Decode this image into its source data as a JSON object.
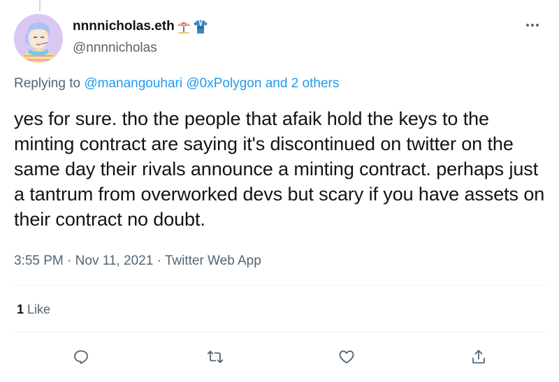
{
  "tweet": {
    "author": {
      "display_name": "nnnnicholas.eth",
      "display_name_emojis": [
        "umbrella-on-ground-icon",
        "kimono-icon"
      ],
      "handle": "@nnnnicholas"
    },
    "replying_to": {
      "prefix": "Replying to",
      "mentions": [
        "@manangouhari",
        "@0xPolygon"
      ],
      "and_text": "and",
      "others_text": "2 others"
    },
    "text": "yes for sure. tho the people that afaik hold the keys to the minting contract are saying it's discontinued on twitter on the same day their rivals announce a minting contract. perhaps just a tantrum from overworked devs but scary if you have assets on their contract no doubt.",
    "time": "3:55 PM",
    "separator": "·",
    "date": "Nov 11, 2021",
    "source": "Twitter Web App",
    "likes_count": "1",
    "likes_label": "Like"
  },
  "actions": [
    "reply-icon",
    "retweet-icon",
    "like-icon",
    "share-icon"
  ],
  "colors": {
    "link": "#1d9bf0",
    "secondary_text": "#536471",
    "primary_text": "#0f1419",
    "divider": "#eff3f4",
    "avatar_bg": "#d7c8f0"
  }
}
